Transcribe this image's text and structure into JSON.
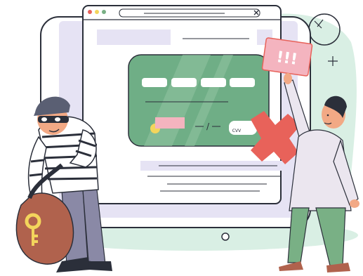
{
  "illustration": {
    "card": {
      "cvv_label": "CVV",
      "date_separator": "/"
    },
    "alert_sign": {
      "text": "!!!"
    },
    "colors": {
      "card_green": "#6fae86",
      "alert_red": "#e8625a",
      "alert_pink": "#f4b4bf",
      "window_lavender": "#e6e3f4",
      "mint_blob": "#d9efe4",
      "bag_brown": "#b0624d",
      "key_yellow": "#f3d55c",
      "pants_green": "#79b085",
      "outline": "#2b2f3a"
    },
    "icons": [
      "close-icon",
      "target-circle-icon",
      "sparkle-icon",
      "key-icon"
    ]
  }
}
